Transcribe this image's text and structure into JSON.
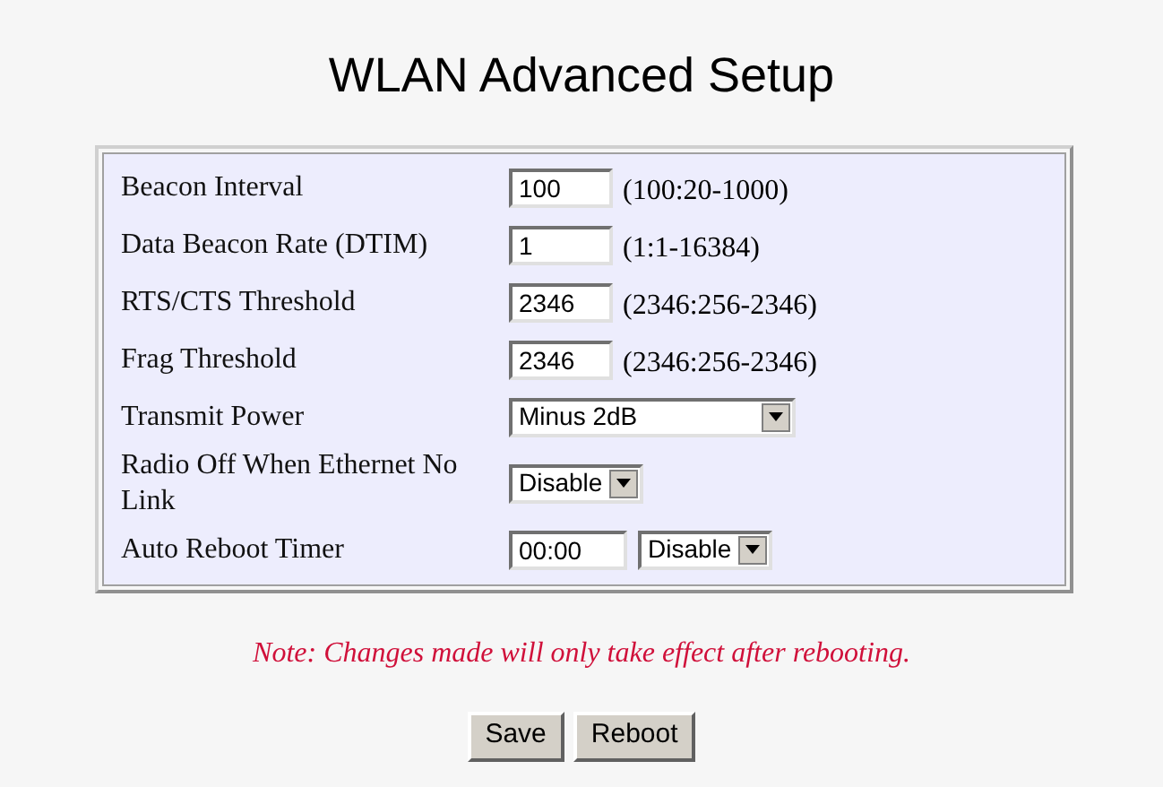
{
  "title": "WLAN Advanced Setup",
  "rows": [
    {
      "kind": "text",
      "label": "Beacon Interval",
      "value": "100",
      "hint": "(100:20-1000)"
    },
    {
      "kind": "text",
      "label": "Data Beacon Rate (DTIM)",
      "value": "1",
      "hint": "(1:1-16384)"
    },
    {
      "kind": "text",
      "label": "RTS/CTS Threshold",
      "value": "2346",
      "hint": "(2346:256-2346)"
    },
    {
      "kind": "text",
      "label": "Frag Threshold",
      "value": "2346",
      "hint": "(2346:256-2346)"
    },
    {
      "kind": "select",
      "label": "Transmit Power",
      "selection": "Minus 2dB"
    },
    {
      "kind": "select",
      "label": "Radio Off When Ethernet No Link",
      "selection": "Disable"
    },
    {
      "kind": "combo",
      "label": "Auto Reboot Timer",
      "value": "00:00",
      "selection": "Disable"
    }
  ],
  "note": "Note: Changes made will only take effect after rebooting.",
  "buttons": [
    "Save",
    "Reboot"
  ]
}
